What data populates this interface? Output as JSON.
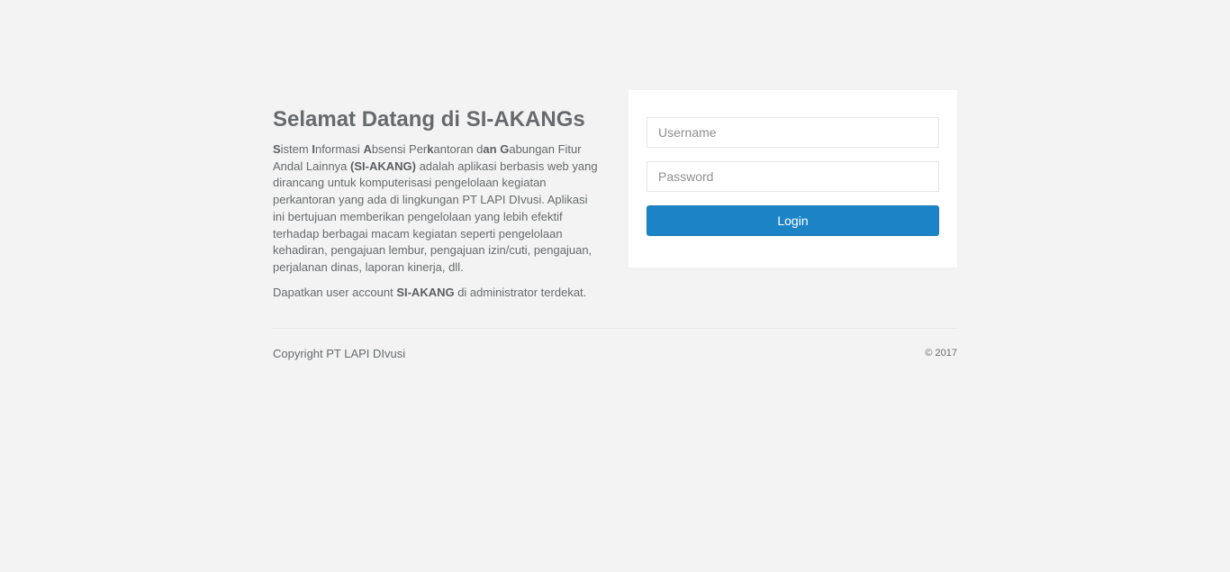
{
  "intro": {
    "title": "Selamat Datang di SI-AKANGs",
    "desc_segments": [
      {
        "bold": true,
        "text": "S"
      },
      {
        "bold": false,
        "text": "istem "
      },
      {
        "bold": true,
        "text": "I"
      },
      {
        "bold": false,
        "text": "nformasi "
      },
      {
        "bold": true,
        "text": "A"
      },
      {
        "bold": false,
        "text": "bsensi Per"
      },
      {
        "bold": true,
        "text": "k"
      },
      {
        "bold": false,
        "text": "antoran d"
      },
      {
        "bold": true,
        "text": "an"
      },
      {
        "bold": false,
        "text": " "
      },
      {
        "bold": true,
        "text": "G"
      },
      {
        "bold": false,
        "text": "abungan Fitur Andal Lainnya "
      },
      {
        "bold": true,
        "text": "(SI-AKANG)"
      },
      {
        "bold": false,
        "text": " adalah aplikasi berbasis web yang dirancang untuk komputerisasi pengelolaan kegiatan perkantoran yang ada di lingkungan PT LAPI DIvusi. Aplikasi ini bertujuan memberikan pengelolaan yang lebih efektif terhadap berbagai macam kegiatan seperti pengelolaan kehadiran, pengajuan lembur, pengajuan izin/cuti, pengajuan, perjalanan dinas, laporan kinerja, dll."
      }
    ],
    "account_prefix": "Dapatkan user account ",
    "account_bold": "SI-AKANG",
    "account_suffix": " di administrator terdekat."
  },
  "login": {
    "username_placeholder": "Username",
    "username_value": "",
    "password_placeholder": "Password",
    "password_value": "",
    "button_label": "Login"
  },
  "footer": {
    "copyright": "Copyright PT LAPI DIvusi",
    "year": "© 2017"
  },
  "colors": {
    "background": "#f3f3f3",
    "primary_button": "#1c84c6",
    "text": "#676a6c"
  }
}
